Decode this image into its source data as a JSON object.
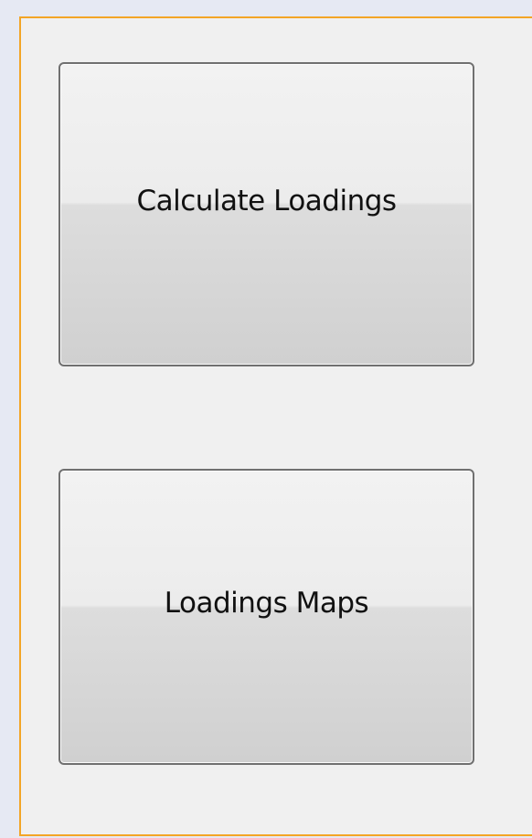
{
  "buttons": {
    "calculate_label": "Calculate Loadings",
    "maps_label": "Loadings Maps"
  },
  "colors": {
    "panel_border": "#f3a526",
    "panel_background": "#f0f0f0",
    "outer_background": "#e6e9f3",
    "button_border": "#707070"
  }
}
